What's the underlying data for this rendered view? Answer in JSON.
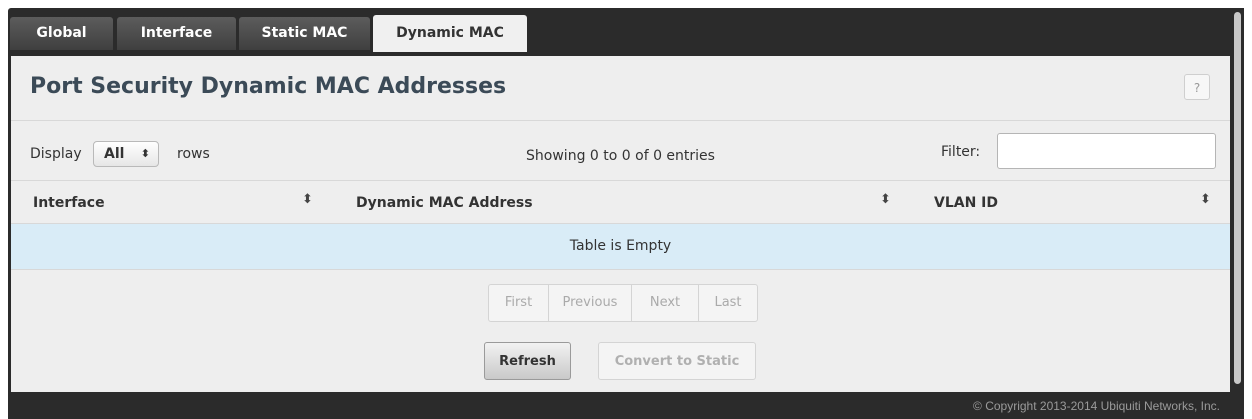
{
  "tabs": [
    {
      "label": "Global",
      "active": false
    },
    {
      "label": "Interface",
      "active": false
    },
    {
      "label": "Static MAC",
      "active": false
    },
    {
      "label": "Dynamic MAC",
      "active": true
    }
  ],
  "page": {
    "title": "Port Security Dynamic MAC Addresses",
    "help_label": "?"
  },
  "controls": {
    "display_label": "Display",
    "rows_select_value": "All",
    "rows_label": "rows",
    "showing_text": "Showing 0 to 0 of 0 entries",
    "filter_label": "Filter:",
    "filter_value": ""
  },
  "table": {
    "columns": [
      "Interface",
      "Dynamic MAC Address",
      "VLAN ID"
    ],
    "sort_icon": "sort-updown-icon",
    "empty_text": "Table is Empty"
  },
  "pagination": [
    "First",
    "Previous",
    "Next",
    "Last"
  ],
  "buttons": {
    "refresh": "Refresh",
    "convert": "Convert to Static"
  },
  "footer": {
    "copyright": "© Copyright 2013-2014 Ubiquiti Networks, Inc."
  },
  "colors": {
    "frame": "#2b2b2b",
    "panel": "#eeeeee",
    "title": "#3b4a57",
    "empty_row": "#d9ecf7"
  }
}
